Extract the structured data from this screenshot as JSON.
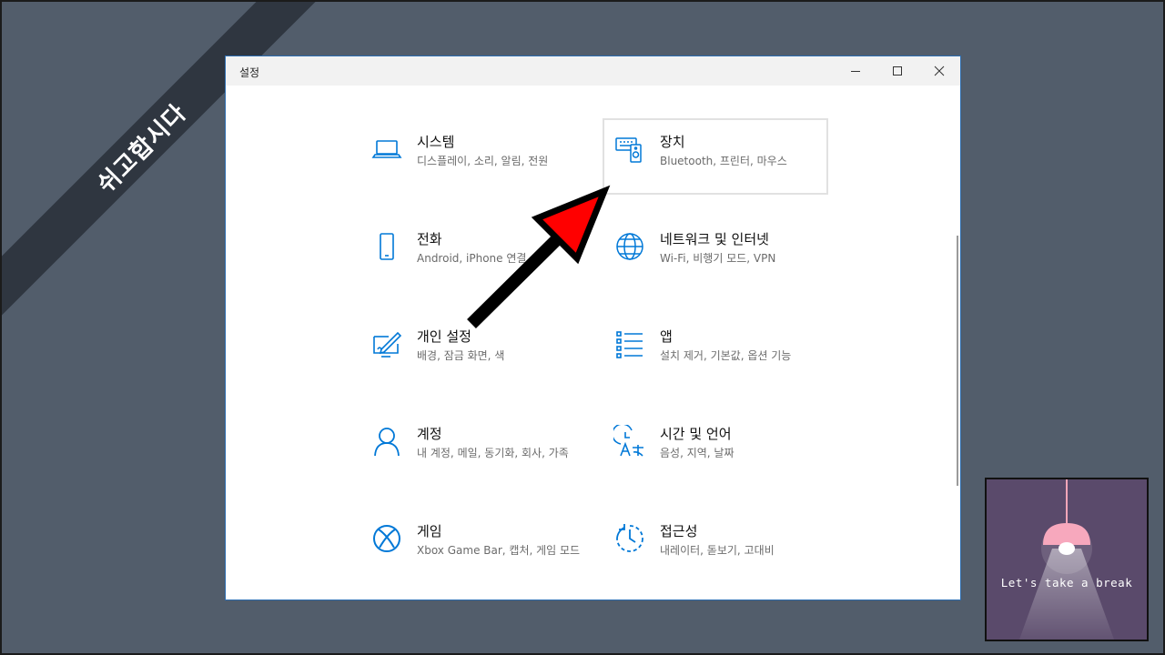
{
  "banner": {
    "text": "쉬고합시다"
  },
  "window": {
    "title": "설정",
    "controls": {
      "minimize": "minimize-icon",
      "maximize": "maximize-icon",
      "close": "close-icon"
    }
  },
  "tiles": [
    {
      "icon": "laptop-icon",
      "title": "시스템",
      "desc": "디스플레이, 소리, 알림, 전원"
    },
    {
      "icon": "keyboard-speaker-icon",
      "title": "장치",
      "desc": "Bluetooth, 프린터, 마우스"
    },
    {
      "icon": "phone-icon",
      "title": "전화",
      "desc": "Android, iPhone 연결"
    },
    {
      "icon": "globe-icon",
      "title": "네트워크 및 인터넷",
      "desc": "Wi-Fi, 비행기 모드, VPN"
    },
    {
      "icon": "pen-tablet-icon",
      "title": "개인 설정",
      "desc": "배경, 잠금 화면, 색"
    },
    {
      "icon": "apps-list-icon",
      "title": "앱",
      "desc": "설치 제거, 기본값, 옵션 기능"
    },
    {
      "icon": "person-icon",
      "title": "계정",
      "desc": "내 계정, 메일, 동기화, 회사, 가족"
    },
    {
      "icon": "language-clock-icon",
      "title": "시간 및 언어",
      "desc": "음성, 지역, 날짜"
    },
    {
      "icon": "xbox-icon",
      "title": "게임",
      "desc": "Xbox Game Bar, 캡처, 게임 모드"
    },
    {
      "icon": "accessibility-icon",
      "title": "접근성",
      "desc": "내레이터, 돋보기, 고대비"
    }
  ],
  "break_box": {
    "text": "Let's take a break"
  },
  "colors": {
    "accent": "#0078d7",
    "arrow": "#ff0000",
    "background": "#525d6b",
    "banner": "#2f3640",
    "break_bg": "#5a4a6b"
  }
}
